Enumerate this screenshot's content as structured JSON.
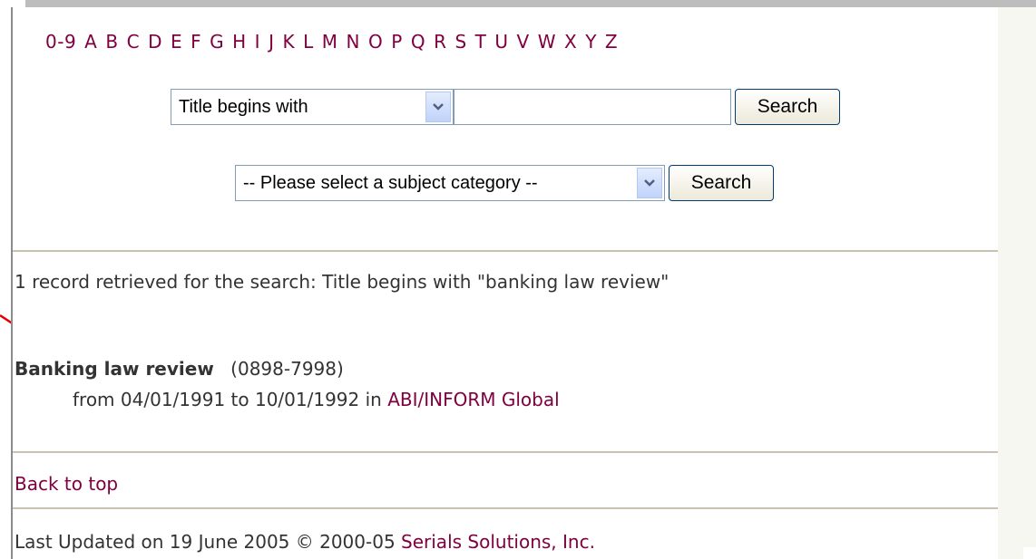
{
  "alphabet": [
    "0-9",
    "A",
    "B",
    "C",
    "D",
    "E",
    "F",
    "G",
    "H",
    "I",
    "J",
    "K",
    "L",
    "M",
    "N",
    "O",
    "P",
    "Q",
    "R",
    "S",
    "T",
    "U",
    "V",
    "W",
    "X",
    "Y",
    "Z"
  ],
  "search": {
    "type_selected": "Title begins with",
    "query_value": "",
    "button_label": "Search"
  },
  "subject": {
    "selected": "-- Please select a subject category --",
    "button_label": "Search"
  },
  "results": {
    "summary": "1 record retrieved for the search: Title begins with \"banking law review\"",
    "items": [
      {
        "title": "Banking law review",
        "issn": "(0898-7998)",
        "coverage_prefix": "from 04/01/1991 to 10/01/1992 in",
        "database": "ABI/INFORM Global"
      }
    ]
  },
  "footer": {
    "back_to_top": "Back to top",
    "last_updated": "Last Updated on 19 June 2005 © 2000-05",
    "company": "Serials Solutions, Inc."
  },
  "colors": {
    "link": "#800040",
    "annotation_arrow": "#e00000"
  },
  "icons": {
    "dropdown": "chevron-down-icon"
  }
}
